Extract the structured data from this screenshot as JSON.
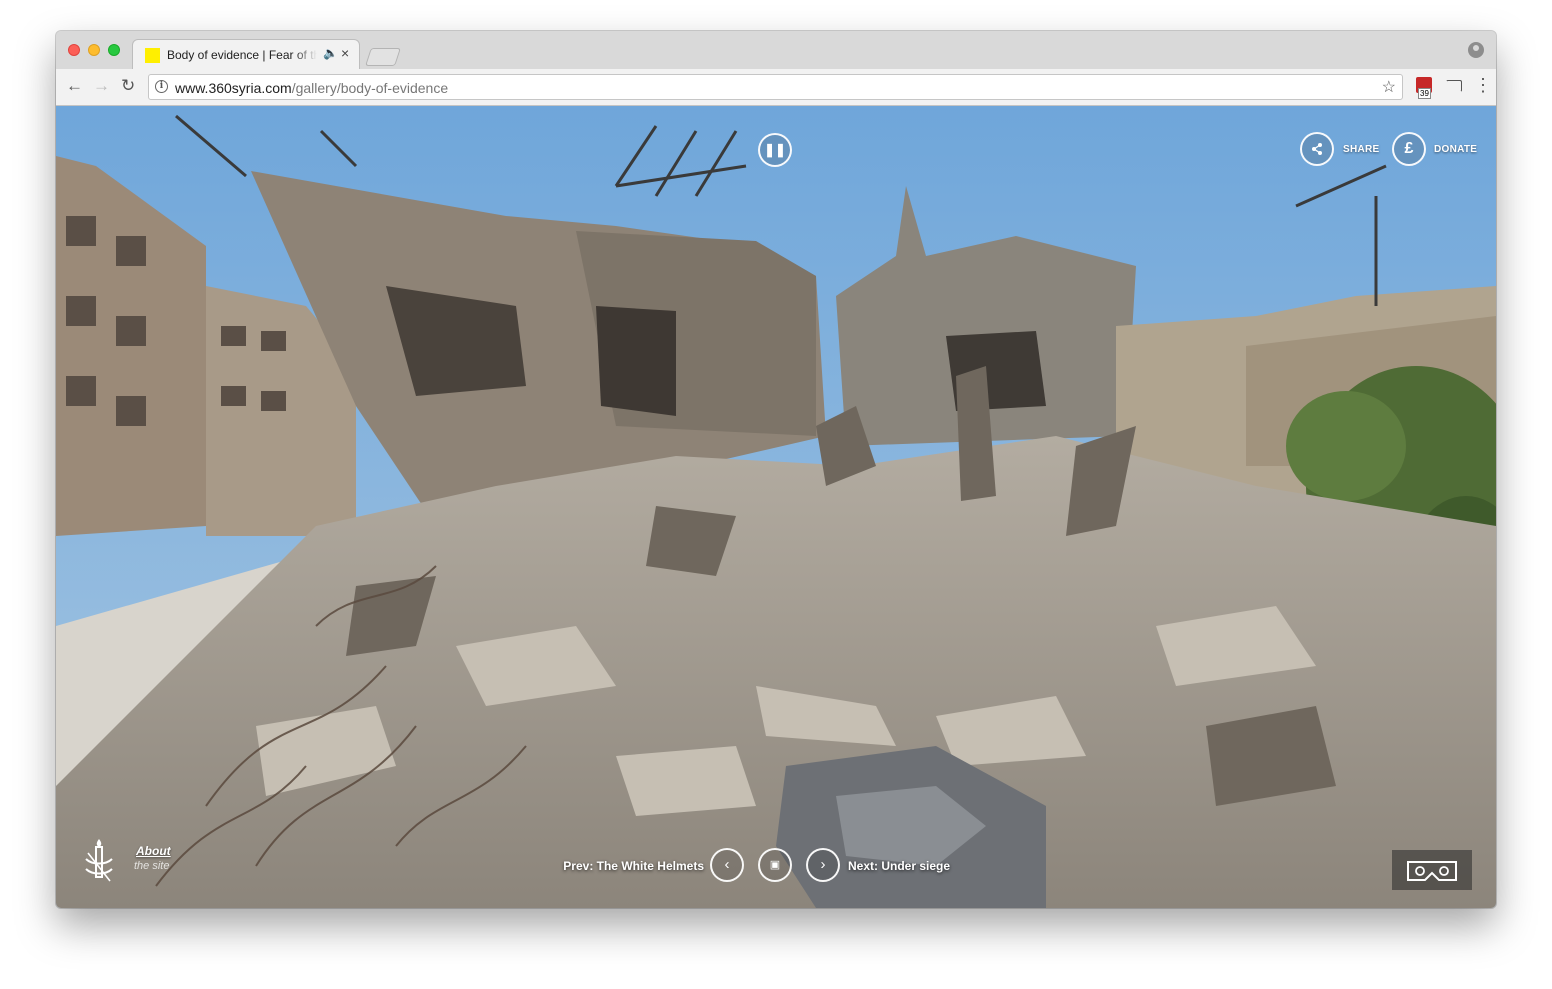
{
  "browser": {
    "tab": {
      "title": "Body of evidence | Fear of the Dark",
      "favicon_color": "#ffef00",
      "audio_icon": "speaker-icon",
      "close_glyph": "×"
    },
    "toolbar": {
      "back_glyph": "←",
      "forward_glyph": "→",
      "reload_glyph": "↻",
      "url_domain": "www.360syria.com",
      "url_path": "/gallery/body-of-evidence",
      "star_glyph": "☆",
      "extension_badge": "39",
      "menu_glyph": "⋮"
    }
  },
  "page": {
    "pause_glyph": "❚❚",
    "share_label": "SHARE",
    "donate_label": "DONATE",
    "donate_glyph": "£",
    "about_label": "About",
    "about_sub": "the site",
    "prev_label": "Prev: The White Helmets",
    "next_label": "Next: Under siege",
    "prev_glyph": "‹",
    "next_glyph": "›",
    "gallery_glyph": "▣",
    "vr_icon": "vr-headset-icon",
    "scene": "360° panorama of destroyed buildings and rubble under a blue sky"
  }
}
